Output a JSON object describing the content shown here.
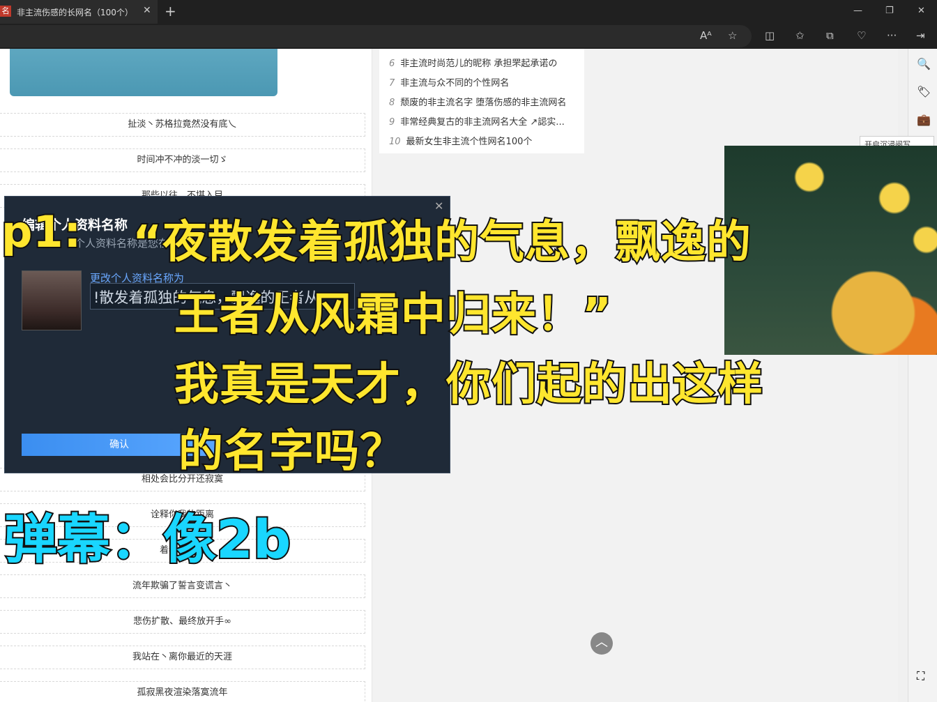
{
  "browser": {
    "tab_title": "非主流伤感的长网名（100个）",
    "favicon": "名",
    "tab_close": "✕",
    "new_tab": "+",
    "window_controls": [
      "—",
      "❐",
      "✕"
    ]
  },
  "toolbar": {
    "icons": [
      "read-aloud-icon",
      "favorite-star-icon",
      "split-screen-icon",
      "favorites-icon",
      "collections-icon",
      "health-icon",
      "more-icon",
      "sidebar-toggle-icon"
    ],
    "glyphs": [
      "Aᴬ",
      "☆",
      "◫",
      "✩",
      "⧉",
      "♡",
      "···",
      "⇥"
    ]
  },
  "sidebar": {
    "icons": [
      "search-icon",
      "tag-icon",
      "briefcase-icon",
      "add-icon",
      "screenshot-icon"
    ],
    "glyphs": [
      "🔍",
      "🏷",
      "💼",
      "+",
      "⛶"
    ]
  },
  "page": {
    "names": [
      "扯淡丶苏格拉竟然没有底乀",
      "时间冲不冲的淡一切ゞ",
      "那些以往，不堪入目",
      "相处会比分开还寂寞",
      "诠释你我的距离",
      "着我的执着",
      "流年欺骗了誓言变谎言丶",
      "悲伤扩散、最终放开手∞",
      "我站在丶离你最近的天涯",
      "孤寂黑夜渲染落寞流年"
    ],
    "related": [
      {
        "num": "6",
        "text": "非主流时尚范儿的昵称 承担罘起承诺の"
      },
      {
        "num": "7",
        "text": "非主流与众不同的个性网名"
      },
      {
        "num": "8",
        "text": "颓废的非主流名字 堕落伤感的非主流网名"
      },
      {
        "num": "9",
        "text": "非常经典复古的非主流网名大全 ↗誋实..."
      },
      {
        "num": "10",
        "text": "最新女生非主流个性网名100个"
      }
    ],
    "back_to_top": "︿",
    "popup_text": "开启沉浸阅写"
  },
  "dialog": {
    "title": "编辑个人资料名称",
    "subtitle": "个人资料名称是您在",
    "change_label": "更改个人资料名称为",
    "input_value": "!散发着孤独的气息，飘逸的王者从",
    "confirm": "确认",
    "close": "✕"
  },
  "captions": {
    "prefix": "p1:",
    "line1": "“夜散发着孤独的气息，飘逸的",
    "line2": "王者从风霜中归来！”",
    "line3": "我真是天才，你们起的出这样",
    "line4": "的名字吗？",
    "danmaku": "弹幕：像2b"
  }
}
